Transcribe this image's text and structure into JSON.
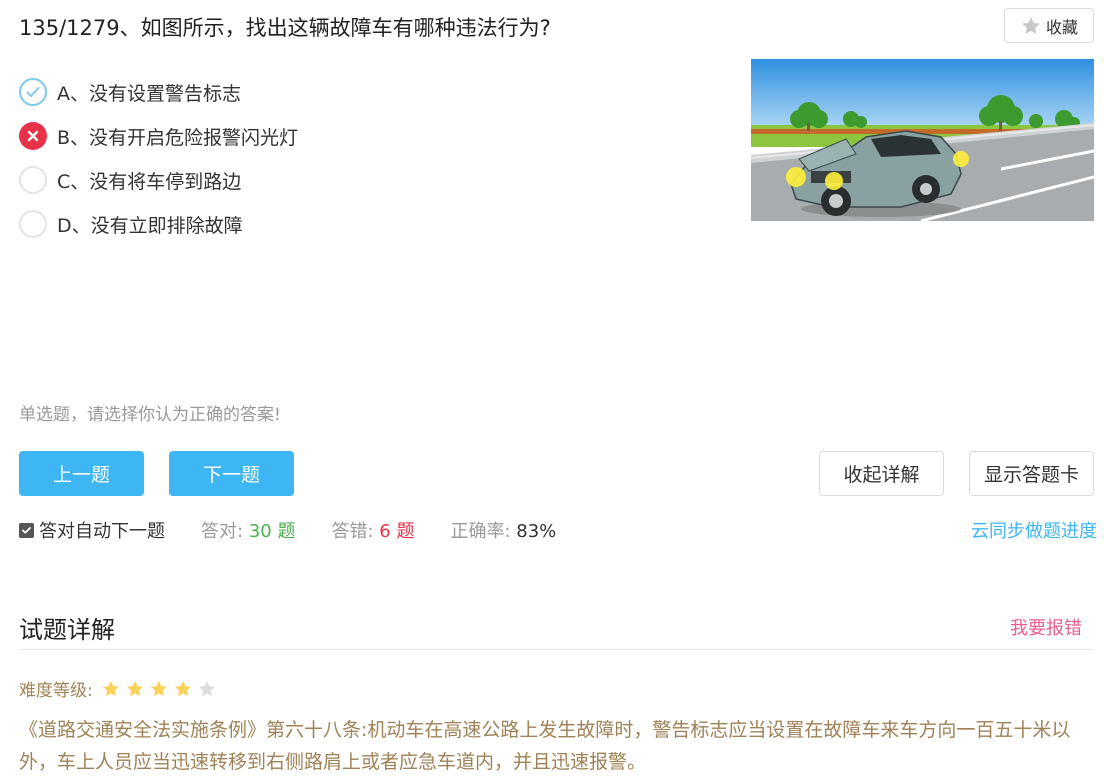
{
  "question": {
    "title": "135/1279、如图所示，找出这辆故障车有哪种违法行为?",
    "favorite_label": "收藏",
    "options": [
      {
        "label": "A、没有设置警告标志",
        "state": "correct"
      },
      {
        "label": "B、没有开启危险报警闪光灯",
        "state": "wrong"
      },
      {
        "label": "C、没有将车停到路边",
        "state": "none"
      },
      {
        "label": "D、没有立即排除故障",
        "state": "none"
      }
    ],
    "hint": "单选题，请选择你认为正确的答案!"
  },
  "buttons": {
    "prev": "上一题",
    "next": "下一题",
    "collapse_detail": "收起详解",
    "show_card": "显示答题卡"
  },
  "stats": {
    "auto_next_label": "答对自动下一题",
    "auto_next_checked": true,
    "correct_label": "答对:",
    "correct_value": "30 题",
    "wrong_label": "答错:",
    "wrong_value": "6 题",
    "rate_label": "正确率:",
    "rate_value": "83%",
    "sync_label": "云同步做题进度"
  },
  "detail": {
    "title": "试题详解",
    "report_label": "我要报错",
    "difficulty_label": "难度等级:",
    "difficulty_stars": 4,
    "difficulty_max": 5,
    "explanation": "《道路交通安全法实施条例》第六十八条:机动车在高速公路上发生故障时，警告标志应当设置在故障车来车方向一百五十米以外，车上人员应当迅速转移到右侧路肩上或者应急车道内，并且迅速报警。"
  },
  "colors": {
    "accent": "#3fb6f4",
    "wrong": "#e8324a",
    "correct_ring": "#7fc8ef",
    "correct_count": "#4caf50",
    "detail_text": "#a08256",
    "report": "#e8618c",
    "star_on": "#fcd15a",
    "star_off": "#dddddd"
  }
}
